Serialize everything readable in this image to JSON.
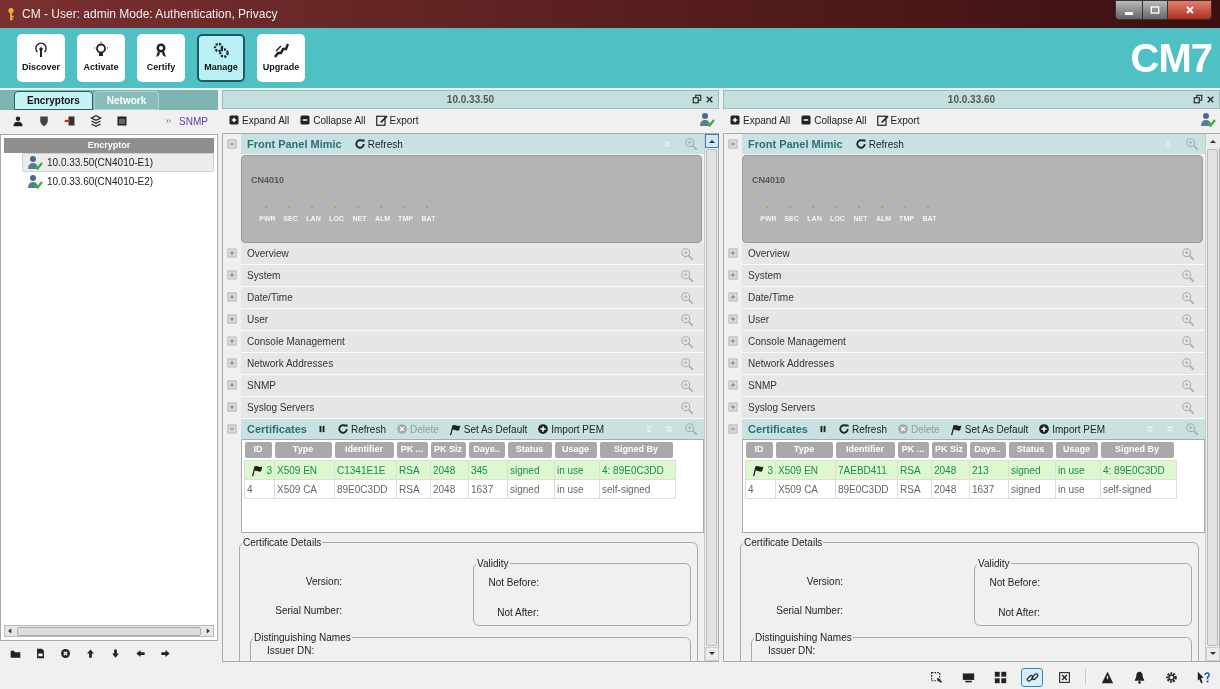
{
  "window": {
    "title": "CM - User: admin  Mode: Authentication, Privacy"
  },
  "toolbar": {
    "buttons": [
      {
        "label": "Discover",
        "selected": false
      },
      {
        "label": "Activate",
        "selected": false
      },
      {
        "label": "Certify",
        "selected": false
      },
      {
        "label": "Manage",
        "selected": true
      },
      {
        "label": "Upgrade",
        "selected": false
      }
    ],
    "logo": "CM7"
  },
  "left_panel": {
    "tabs": [
      {
        "label": "Encryptors",
        "selected": true
      },
      {
        "label": "Network",
        "selected": false
      }
    ],
    "snmp": "SNMP",
    "column_header": "Encryptor",
    "items": [
      {
        "label": "10.0.33.50(CN4010-E1)",
        "selected": true
      },
      {
        "label": "10.0.33.60(CN4010-E2)",
        "selected": false
      }
    ]
  },
  "devices": [
    {
      "title": "10.0.33.50",
      "toolbar": [
        "Expand All",
        "Collapse All",
        "Export"
      ],
      "front_panel": {
        "title": "Front Panel Mimic",
        "refresh": "Refresh",
        "model": "CN4010",
        "leds": [
          "PWR",
          "SEC",
          "LAN",
          "LOC",
          "NET",
          "ALM",
          "TMP",
          "BAT"
        ]
      },
      "sections": [
        "Overview",
        "System",
        "Date/Time",
        "User",
        "Console Management",
        "Network Addresses",
        "SNMP",
        "Syslog Servers"
      ],
      "certificates": {
        "title": "Certificates",
        "actions": [
          {
            "label": "Refresh",
            "disabled": false
          },
          {
            "label": "Delete",
            "disabled": true
          },
          {
            "label": "Set As Default",
            "disabled": false
          },
          {
            "label": "Import PEM",
            "disabled": false
          }
        ],
        "columns": [
          "ID",
          "Type",
          "Identifier",
          "PK ...",
          "PK Siz",
          "Days..",
          "Status",
          "Usage",
          "Signed By"
        ],
        "rows": [
          {
            "cells": [
              "3",
              "X509 EN",
              "C1341E1E",
              "RSA",
              "2048",
              "345",
              "signed",
              "in use",
              "4: 89E0C3DD"
            ],
            "default": true
          },
          {
            "cells": [
              "4",
              "X509 CA",
              "89E0C3DD",
              "RSA",
              "2048",
              "1637",
              "signed",
              "in use",
              "self-signed"
            ],
            "default": false
          }
        ],
        "details": {
          "title": "Certificate Details",
          "version": "Version:",
          "serial": "Serial Number:",
          "validity": {
            "title": "Validity",
            "not_before": "Not Before:",
            "not_after": "Not After:"
          },
          "names": {
            "title": "Distinguishing Names",
            "issuer": "Issuer DN:"
          }
        }
      }
    },
    {
      "title": "10.0.33.60",
      "toolbar": [
        "Expand All",
        "Collapse All",
        "Export"
      ],
      "front_panel": {
        "title": "Front Panel Mimic",
        "refresh": "Refresh",
        "model": "CN4010",
        "leds": [
          "PWR",
          "SEC",
          "LAN",
          "LOC",
          "NET",
          "ALM",
          "TMP",
          "BAT"
        ]
      },
      "sections": [
        "Overview",
        "System",
        "Date/Time",
        "User",
        "Console Management",
        "Network Addresses",
        "SNMP",
        "Syslog Servers"
      ],
      "certificates": {
        "title": "Certificates",
        "actions": [
          {
            "label": "Refresh",
            "disabled": false
          },
          {
            "label": "Delete",
            "disabled": true
          },
          {
            "label": "Set As Default",
            "disabled": false
          },
          {
            "label": "Import PEM",
            "disabled": false
          }
        ],
        "columns": [
          "ID",
          "Type",
          "Identifier",
          "PK ...",
          "PK Siz",
          "Days..",
          "Status",
          "Usage",
          "Signed By"
        ],
        "rows": [
          {
            "cells": [
              "3",
              "X509 EN",
              "7AEBD411",
              "RSA",
              "2048",
              "213",
              "signed",
              "in use",
              "4: 89E0C3DD"
            ],
            "default": true
          },
          {
            "cells": [
              "4",
              "X509 CA",
              "89E0C3DD",
              "RSA",
              "2048",
              "1637",
              "signed",
              "in use",
              "self-signed"
            ],
            "default": false
          }
        ],
        "details": {
          "title": "Certificate Details",
          "version": "Version:",
          "serial": "Serial Number:",
          "validity": {
            "title": "Validity",
            "not_before": "Not Before:",
            "not_after": "Not After:"
          },
          "names": {
            "title": "Distinguishing Names",
            "issuer": "Issuer DN:"
          }
        }
      }
    }
  ],
  "status_bar": {
    "tools": [
      {
        "selected": false
      },
      {
        "selected": false
      },
      {
        "selected": false
      },
      {
        "selected": true
      },
      {
        "selected": false
      },
      {
        "selected": false
      },
      {
        "selected": false
      },
      {
        "selected": false
      },
      {
        "selected": false
      }
    ]
  }
}
